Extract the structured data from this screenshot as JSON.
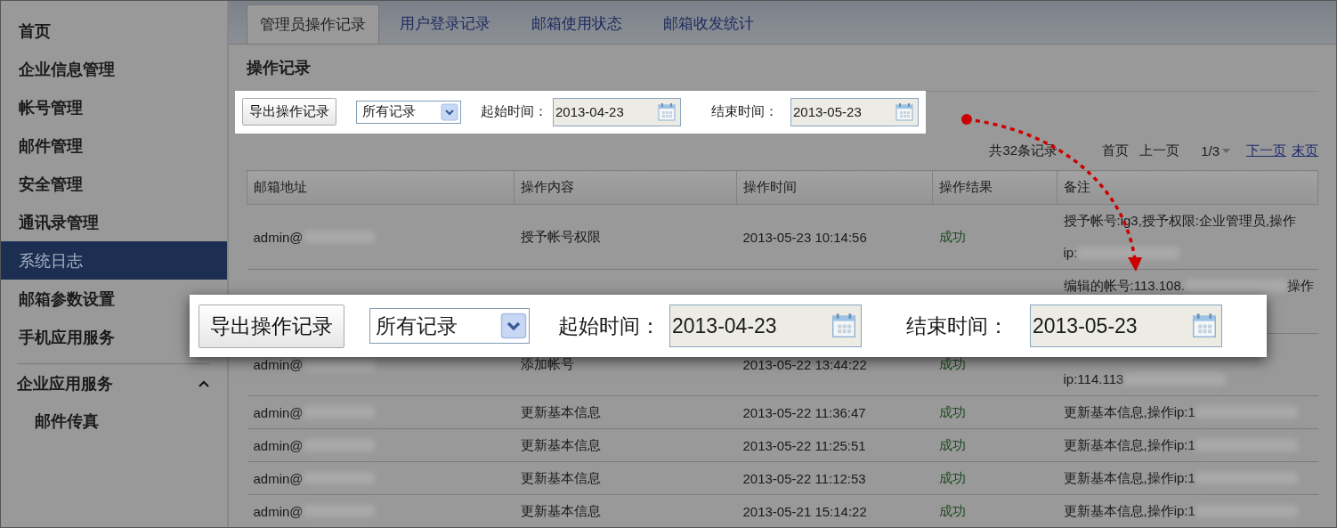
{
  "sidebar": {
    "items": [
      {
        "label": "首页",
        "selected": false
      },
      {
        "label": "企业信息管理",
        "selected": false
      },
      {
        "label": "帐号管理",
        "selected": false
      },
      {
        "label": "邮件管理",
        "selected": false
      },
      {
        "label": "安全管理",
        "selected": false
      },
      {
        "label": "通讯录管理",
        "selected": false
      },
      {
        "label": "系统日志",
        "selected": true
      },
      {
        "label": "邮箱参数设置",
        "selected": false
      },
      {
        "label": "手机应用服务",
        "selected": false
      }
    ],
    "groups": [
      {
        "label": "企业应用服务",
        "expanded": true,
        "children": [
          {
            "label": "邮件传真",
            "selected": false
          }
        ]
      }
    ]
  },
  "tabs": [
    {
      "label": "管理员操作记录",
      "selected": true
    },
    {
      "label": "用户登录记录",
      "selected": false
    },
    {
      "label": "邮箱使用状态",
      "selected": false
    },
    {
      "label": "邮箱收发统计",
      "selected": false
    }
  ],
  "section_title": "操作记录",
  "toolbar": {
    "export_button": "导出操作记录",
    "filter": "所有记录",
    "start_label": "起始时间：",
    "start_date": "2013-04-23",
    "end_label": "结束时间：",
    "end_date": "2013-05-23"
  },
  "pagination": {
    "total": "共32条记录",
    "first": "首页",
    "prev": "上一页",
    "page": "1/3",
    "next": "下一页",
    "last": "末页"
  },
  "table": {
    "columns": [
      "邮箱地址",
      "操作内容",
      "操作时间",
      "操作结果",
      "备注"
    ],
    "rows": [
      {
        "email": "admin@",
        "content": "授予帐号权限",
        "time": "2013-05-23 10:14:56",
        "result": "成功",
        "remark": [
          [
            {
              "text": "授予帐号:ig3,授予权限:企业管理员,操作"
            }
          ],
          [
            {
              "text": "ip:"
            },
            {
              "kind": "blur"
            }
          ]
        ]
      },
      {
        "remark": [
          [
            {
              "text": "编辑的帐号:113.108."
            },
            {
              "kind": "blur"
            },
            {
              "text": "操作"
            }
          ]
        ]
      },
      {
        "email": "admin@",
        "content": "添加帐号",
        "time": "2013-05-22 13:44:22",
        "result": "成功",
        "remark": [
          [
            {
              "text": "ip:114.113"
            },
            {
              "kind": "blur"
            }
          ]
        ]
      },
      {
        "email": "admin@",
        "content": "更新基本信息",
        "time": "2013-05-22 11:36:47",
        "result": "成功",
        "remark": [
          [
            {
              "text": "更新基本信息,操作ip:1"
            },
            {
              "kind": "blur"
            }
          ]
        ]
      },
      {
        "email": "admin@",
        "content": "更新基本信息",
        "time": "2013-05-22 11:25:51",
        "result": "成功",
        "remark": [
          [
            {
              "text": "更新基本信息,操作ip:1"
            },
            {
              "kind": "blur"
            }
          ]
        ]
      },
      {
        "email": "admin@",
        "content": "更新基本信息",
        "time": "2013-05-22 11:12:53",
        "result": "成功",
        "remark": [
          [
            {
              "text": "更新基本信息,操作ip:1"
            },
            {
              "kind": "blur"
            }
          ]
        ]
      },
      {
        "email": "admin@",
        "content": "更新基本信息",
        "time": "2013-05-21 15:14:22",
        "result": "成功",
        "remark": [
          [
            {
              "text": "更新基本信息,操作ip:1"
            },
            {
              "kind": "blur"
            }
          ]
        ]
      }
    ]
  },
  "magnified_toolbar": {
    "export_button": "导出操作记录",
    "filter": "所有记录",
    "start_label": "起始时间：",
    "start_date": "2013-04-23",
    "end_label": "结束时间：",
    "end_date": "2013-05-23"
  }
}
